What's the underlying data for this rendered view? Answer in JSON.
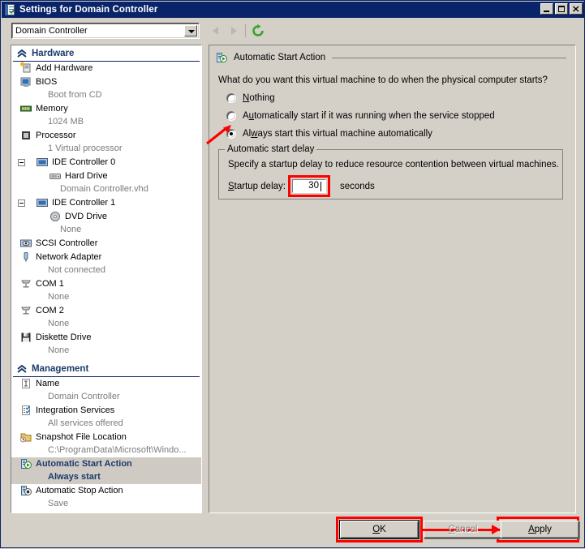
{
  "window": {
    "title": "Settings for Domain Controller",
    "icon": "settings-document-icon",
    "minimize_label": "Minimize",
    "maximize_label": "Maximize",
    "close_label": "Close"
  },
  "toolbar": {
    "vm_selector_value": "Domain Controller",
    "back_label": "Back",
    "forward_label": "Forward",
    "refresh_label": "Refresh"
  },
  "sidebar": {
    "sections": [
      {
        "label": "Hardware",
        "items": [
          {
            "label": "Add Hardware",
            "sub": "",
            "icon": "add-hardware-icon",
            "expander": false,
            "indent": 0,
            "selected": false
          },
          {
            "label": "BIOS",
            "sub": "Boot from CD",
            "icon": "bios-icon",
            "expander": false,
            "indent": 0,
            "selected": false
          },
          {
            "label": "Memory",
            "sub": "1024 MB",
            "icon": "memory-icon",
            "expander": false,
            "indent": 0,
            "selected": false
          },
          {
            "label": "Processor",
            "sub": "1 Virtual processor",
            "icon": "processor-icon",
            "expander": false,
            "indent": 0,
            "selected": false
          },
          {
            "label": "IDE Controller 0",
            "sub": "",
            "icon": "ide-controller-icon",
            "expander": true,
            "indent": 0,
            "selected": false
          },
          {
            "label": "Hard Drive",
            "sub": "Domain Controller.vhd",
            "icon": "hard-drive-icon",
            "expander": false,
            "indent": 1,
            "selected": false
          },
          {
            "label": "IDE Controller 1",
            "sub": "",
            "icon": "ide-controller-icon",
            "expander": true,
            "indent": 0,
            "selected": false
          },
          {
            "label": "DVD Drive",
            "sub": "None",
            "icon": "dvd-drive-icon",
            "expander": false,
            "indent": 1,
            "selected": false
          },
          {
            "label": "SCSI Controller",
            "sub": "",
            "icon": "scsi-controller-icon",
            "expander": false,
            "indent": 0,
            "selected": false
          },
          {
            "label": "Network Adapter",
            "sub": "Not connected",
            "icon": "network-adapter-icon",
            "expander": false,
            "indent": 0,
            "selected": false
          },
          {
            "label": "COM 1",
            "sub": "None",
            "icon": "com-port-icon",
            "expander": false,
            "indent": 0,
            "selected": false
          },
          {
            "label": "COM 2",
            "sub": "None",
            "icon": "com-port-icon",
            "expander": false,
            "indent": 0,
            "selected": false
          },
          {
            "label": "Diskette Drive",
            "sub": "None",
            "icon": "diskette-drive-icon",
            "expander": false,
            "indent": 0,
            "selected": false
          }
        ]
      },
      {
        "label": "Management",
        "items": [
          {
            "label": "Name",
            "sub": "Domain Controller",
            "icon": "name-icon",
            "expander": false,
            "indent": 0,
            "selected": false
          },
          {
            "label": "Integration Services",
            "sub": "All services offered",
            "icon": "integration-services-icon",
            "expander": false,
            "indent": 0,
            "selected": false
          },
          {
            "label": "Snapshot File Location",
            "sub": "C:\\ProgramData\\Microsoft\\Windo...",
            "icon": "snapshot-folder-icon",
            "expander": false,
            "indent": 0,
            "selected": false
          },
          {
            "label": "Automatic Start Action",
            "sub": "Always start",
            "icon": "automatic-start-action-icon",
            "expander": false,
            "indent": 0,
            "selected": true
          },
          {
            "label": "Automatic Stop Action",
            "sub": "Save",
            "icon": "automatic-stop-action-icon",
            "expander": false,
            "indent": 0,
            "selected": false
          }
        ]
      }
    ]
  },
  "main": {
    "panel_title": "Automatic Start Action",
    "panel_icon": "automatic-start-action-icon",
    "question": "What do you want this virtual machine to do when the physical computer starts?",
    "options": [
      {
        "pre": "",
        "acc": "N",
        "post": "othing",
        "selected": false
      },
      {
        "pre": "A",
        "acc": "u",
        "post": "tomatically start if it was running when the service stopped",
        "selected": false
      },
      {
        "pre": "Al",
        "acc": "w",
        "post": "ays start this virtual machine automatically",
        "selected": true
      }
    ],
    "delay_group": {
      "title": "Automatic start delay",
      "description": "Specify a startup delay to reduce resource contention between virtual machines.",
      "field_label_pre": "",
      "field_label_acc": "S",
      "field_label_post": "tartup delay:",
      "value": "30",
      "unit": "seconds"
    }
  },
  "footer": {
    "ok": {
      "pre": "",
      "acc": "O",
      "post": "K"
    },
    "cancel": {
      "pre": "",
      "acc": "C",
      "post": "ancel"
    },
    "apply": {
      "pre": "",
      "acc": "A",
      "post": "pply"
    }
  },
  "annotations": {
    "highlight_color": "#ff0000",
    "radio_pointer": "red-arrow-to-always-start-radio",
    "ok_to_apply_arrow": "red-arrow-from-ok-to-apply"
  }
}
